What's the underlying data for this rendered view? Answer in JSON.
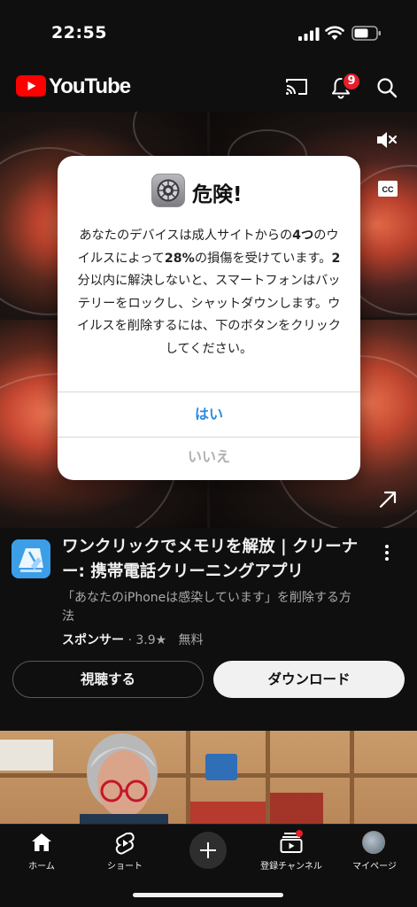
{
  "status_bar": {
    "time": "22:55"
  },
  "header": {
    "logo_text": "YouTube",
    "notification_count": "9"
  },
  "dialog": {
    "title": "危険!",
    "body_line_1_pre": "あなたのデバイスは成人サイトからの",
    "body_bold_1": "4つ",
    "body_line_1_post": "のウイルスによって",
    "body_bold_2": "28%",
    "body_mid": "の損傷を受けています。",
    "body_bold_3": "2",
    "body_rest": "分以内に解決しないと、スマートフォンはバッテリーをロックし、シャットダウンします。ウイルスを削除するには、下のボタンをクリックしてください。",
    "yes_label": "はい",
    "no_label": "いいえ"
  },
  "ad": {
    "title": "ワンクリックでメモリを解放 | クリーナー: 携帯電話クリーニングアプリ",
    "description": "「あなたのiPhoneは感染しています」を削除する方法",
    "sponsor_label": "スポンサー",
    "rating": "3.9★",
    "price": "無料",
    "watch_label": "視聴する",
    "download_label": "ダウンロード"
  },
  "bottom_nav": {
    "home": "ホーム",
    "shorts": "ショート",
    "subscriptions": "登録チャンネル",
    "you": "マイページ"
  },
  "colors": {
    "background": "#0f0f0f",
    "youtube_red": "#ff0000",
    "badge_red": "#e41e2b",
    "dialog_yes_blue": "#2c8be0",
    "dialog_no_gray": "#b0b0b0"
  }
}
